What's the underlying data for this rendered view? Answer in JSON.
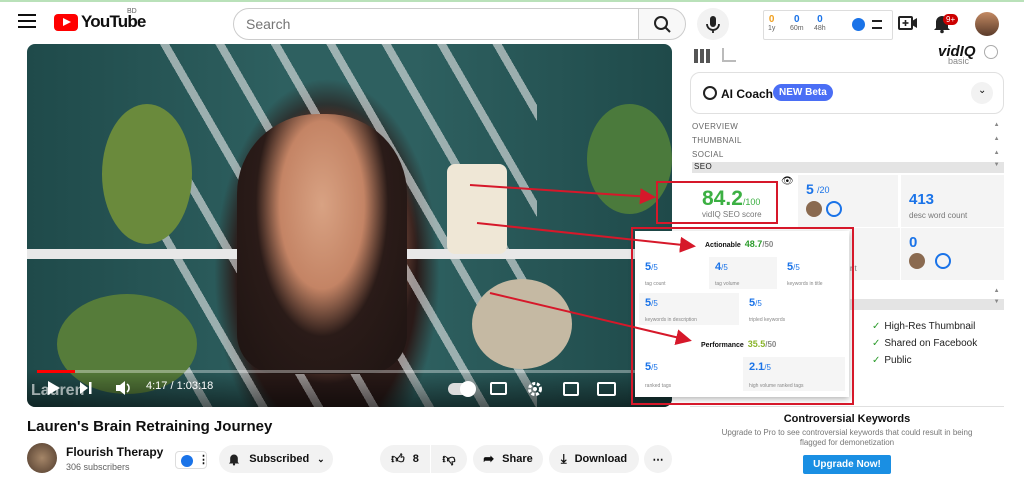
{
  "header": {
    "logo_text": "YouTube",
    "country_code": "BD",
    "search_placeholder": "Search",
    "stats": [
      {
        "value": "0",
        "label": "1y"
      },
      {
        "value": "0",
        "label": "60m"
      },
      {
        "value": "0",
        "label": "48h"
      }
    ],
    "notif_badge": "9+"
  },
  "video": {
    "watermark": "Lauren",
    "time": "4:17 / 1:03:18",
    "progress": 0.06,
    "title": "Lauren's Brain Retraining Journey"
  },
  "channel": {
    "name": "Flourish Therapy",
    "subs": "306 subscribers",
    "subscribe_label": "Subscribed",
    "likes": "8",
    "share_label": "Share",
    "download_label": "Download"
  },
  "sidebar": {
    "vidiq_logo": "vidIQ",
    "plan": "basic",
    "coach_title": "AI Coach",
    "coach_badge": "NEW Beta",
    "sections": [
      "OVERVIEW",
      "THUMBNAIL",
      "SOCIAL",
      "SEO"
    ],
    "seo_score": "84.2",
    "seo_score_max": "/100",
    "seo_score_label": "vidIQ SEO score",
    "card2_value": "5",
    "card2_max": "/20",
    "word_count": "413",
    "word_count_label": "desc word count",
    "card5_value": "0",
    "card6_fragment": "nt",
    "checks": [
      "High-Res Thumbnail",
      "Shared on Facebook",
      "Public"
    ],
    "controversial_title": "Controversial Keywords",
    "controversial_desc": "Upgrade to Pro to see controversial keywords that could result in being flagged for demonetization",
    "upgrade_label": "Upgrade Now!"
  },
  "popup": {
    "actionable_label": "Actionable",
    "actionable_score": "48.7",
    "actionable_max": "/50",
    "performance_label": "Performance",
    "performance_score": "35.5",
    "performance_max": "/50",
    "cells": [
      {
        "value": "5",
        "max": "/5",
        "label": "tag count"
      },
      {
        "value": "4",
        "max": "/5",
        "label": "tag volume"
      },
      {
        "value": "5",
        "max": "/5",
        "label": "keywords in title"
      },
      {
        "value": "5",
        "max": "/5",
        "label": "keywords in description"
      },
      {
        "value": "5",
        "max": "/5",
        "label": "tripled keywords"
      },
      {
        "value": "5",
        "max": "/5",
        "label": "ranked tags"
      },
      {
        "value": "2.1",
        "max": "/5",
        "label": "high volume ranked tags"
      }
    ]
  },
  "colors": {
    "accent": "#1a73e8",
    "brand_red": "#ff0000",
    "annotation_red": "#d6182a",
    "score_green": "#3cb043"
  }
}
